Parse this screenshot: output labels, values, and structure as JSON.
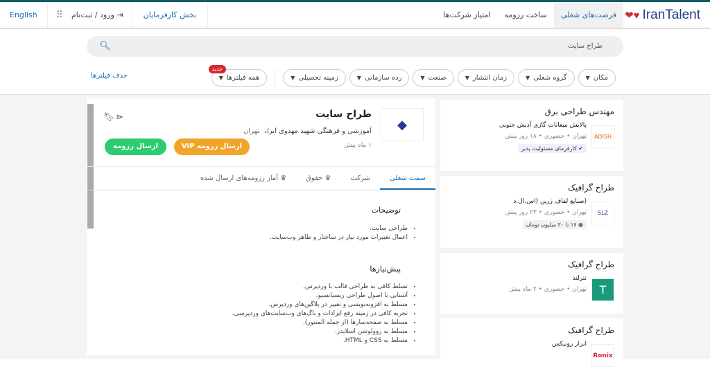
{
  "header": {
    "logo": "IranTalent",
    "nav": [
      "فرصت‌های شغلی",
      "ساخت رزومه",
      "امتیاز شرکت‌ها"
    ],
    "employers": "بخش کارفرمایان",
    "login": "ورود / ثبت‌نام",
    "language": "English"
  },
  "search": {
    "value": "طراح سایت"
  },
  "filters": {
    "chips": [
      "مکان",
      "گروه شغلی",
      "زمان انتشار",
      "صنعت",
      "رده سازمانی",
      "زمینه تحصیلی"
    ],
    "all": "همه فیلترها",
    "new_badge": "جدید",
    "clear": "حذف فیلترها"
  },
  "job": {
    "title": "طراح سایت",
    "company": "آموزشی و فرهنگی شهید مهدوی ایران",
    "city": "تهران",
    "posted": "۱ ماه پیش",
    "vip_button": "ارسال رزومه VIP",
    "send_button": "ارسال رزومه",
    "tabs": [
      "سمت شغلی",
      "شرکت",
      "حقوق",
      "آمار رزومه‌های ارسال شده"
    ],
    "description_title": "توضیحات",
    "description": [
      "طراحی سایت.",
      "اعمال تغییرات مورد نیاز در ساختار و ظاهر وب‌سایت."
    ],
    "requirements_title": "پیش‌نیازها",
    "requirements": [
      "تسلط کافی به طراحی قالب با وردپرس.",
      "آشنایی با اصول طراحی ریسپانسیو.",
      "مسلط به افزونه‌نویسی و تغییر در پلاگین‌های وردپرس.",
      "تجربه کافی در زمینه رفع ایرادات و باگ‌های وب‌سایت‌های وردپرسی.",
      "مسلط به صفحه‌سازها (از جمله المنتور).",
      "مسلط به روولوشن اسلایدر.",
      "مسلط به CSS و HTML."
    ]
  },
  "list": [
    {
      "title": "مهندس طراحی برق",
      "company": "پالایش میعانات گازی آدیش جنوبی",
      "meta": "تهران • حضوری • ۱۸ روز پیش",
      "tag": "کارفرمای مسئولیت پذیر",
      "logo": "ADISH"
    },
    {
      "title": "طراح گرافیک",
      "company": "(صنایع لفاف زرین (اس.ال.ذ",
      "meta": "تهران • حضوری • ۲۳ روز پیش",
      "tag": "۱۷ تا ۲۰ میلیون تومان",
      "logo": "SLZ"
    },
    {
      "title": "طراح گرافیک",
      "company": "تترلند",
      "meta": "تهران • حضوری • ۲ ماه پیش",
      "logo": "T"
    },
    {
      "title": "طراح گرافیک",
      "company": "ابزار رونیکس",
      "logo": "Ronix"
    }
  ]
}
